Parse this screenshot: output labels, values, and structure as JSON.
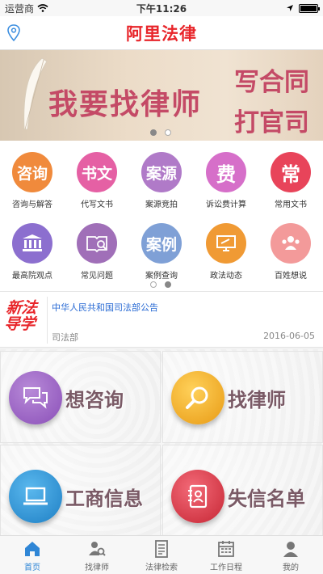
{
  "status_bar": {
    "carrier": "运营商",
    "time": "下午11:26"
  },
  "nav": {
    "title": "阿里法律"
  },
  "banner": {
    "main_text": "我要找律师",
    "line1": "写合同",
    "line2": "打官司",
    "page_count": 2,
    "active_page": 1
  },
  "grid": {
    "row1": [
      {
        "glyph": "咨询",
        "label": "咨询与解答",
        "color": "#f08a3c"
      },
      {
        "glyph": "书文",
        "label": "代写文书",
        "color": "#e560a4"
      },
      {
        "glyph": "案源",
        "label": "案源竞拍",
        "color": "#b07ac8"
      },
      {
        "glyph": "费",
        "label": "诉讼费计算",
        "color": "#d66fc9"
      },
      {
        "glyph": "常",
        "label": "常用文书",
        "color": "#e8445a"
      }
    ],
    "row2": [
      {
        "label": "最高院观点",
        "color": "#8c6fcf",
        "icon": "court-icon"
      },
      {
        "label": "常见问题",
        "color": "#a06fb8",
        "icon": "book-search-icon"
      },
      {
        "glyph": "案例",
        "label": "案例查询",
        "color": "#7fa0d6"
      },
      {
        "label": "政法动态",
        "color": "#f09a34",
        "icon": "monitor-icon"
      },
      {
        "label": "百姓想说",
        "color": "#f39a9a",
        "icon": "people-icon"
      }
    ],
    "page_count": 2,
    "active_page": 2
  },
  "news": {
    "logo_line1": "新法",
    "logo_line2": "导学",
    "headline": "中华人民共和国司法部公告",
    "source": "司法部",
    "date": "2016-06-05"
  },
  "tiles": [
    {
      "label": "想咨询",
      "color": "#9a5fc4",
      "icon": "chat-icon"
    },
    {
      "label": "找律师",
      "color": "#f2b128",
      "icon": "magnifier-icon"
    },
    {
      "label": "工商信息",
      "color": "#2e9bde",
      "icon": "laptop-icon"
    },
    {
      "label": "失信名单",
      "color": "#e83d4d",
      "icon": "contacts-book-icon"
    }
  ],
  "tabbar": {
    "items": [
      {
        "label": "首页",
        "active": true,
        "icon": "home-icon"
      },
      {
        "label": "找律师",
        "active": false,
        "icon": "lawyer-search-icon"
      },
      {
        "label": "法律检索",
        "active": false,
        "icon": "document-icon"
      },
      {
        "label": "工作日程",
        "active": false,
        "icon": "calendar-icon"
      },
      {
        "label": "我的",
        "active": false,
        "icon": "user-icon"
      }
    ]
  },
  "colors": {
    "brand_red": "#e8252a",
    "link_blue": "#2a6bd4",
    "tab_active": "#2f86d6"
  }
}
